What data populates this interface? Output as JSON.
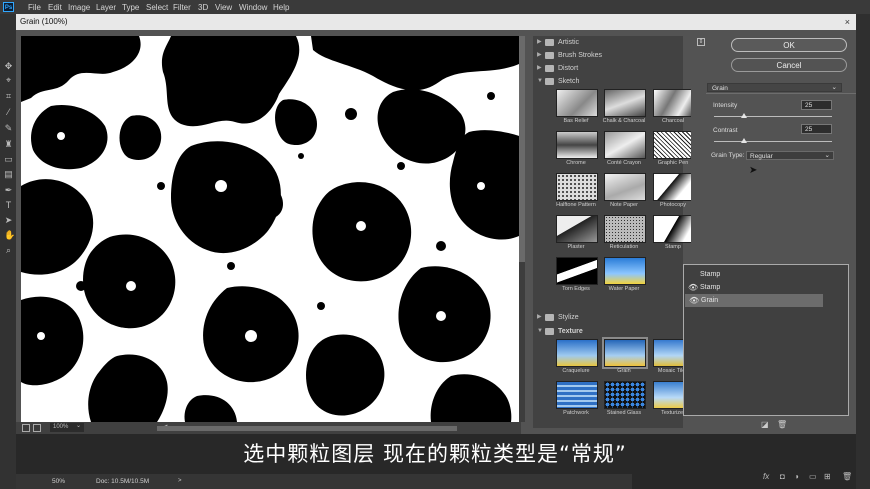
{
  "menubar": {
    "logo": "Ps",
    "items": [
      "File",
      "Edit",
      "Image",
      "Layer",
      "Type",
      "Select",
      "Filter",
      "3D",
      "View",
      "Window",
      "Help"
    ]
  },
  "dialog": {
    "title": "Grain (100%)",
    "close_glyph": "×",
    "zoom_level": "100%",
    "zoom_arrow": "⌄"
  },
  "filter_gallery": {
    "categories": [
      {
        "label": "Artistic",
        "expanded": false
      },
      {
        "label": "Brush Strokes",
        "expanded": false
      },
      {
        "label": "Distort",
        "expanded": false
      },
      {
        "label": "Sketch",
        "expanded": true
      },
      {
        "label": "Stylize",
        "expanded": false
      },
      {
        "label": "Texture",
        "expanded": true
      }
    ],
    "sketch_filters": [
      "Bas Relief",
      "Chalk & Charcoal",
      "Charcoal",
      "Chrome",
      "Conté Crayon",
      "Graphic Pen",
      "Halftone Pattern",
      "Note Paper",
      "Photocopy",
      "Plaster",
      "Reticulation",
      "Stamp",
      "Torn Edges",
      "Water Paper"
    ],
    "texture_filters": [
      "Craquelure",
      "Grain",
      "Mosaic Tiles",
      "Patchwork",
      "Stained Glass",
      "Texturizer"
    ],
    "selected_filter": "Grain"
  },
  "settings": {
    "ok_label": "OK",
    "cancel_label": "Cancel",
    "filter_name": "Grain",
    "select_arrow": "⌄",
    "intensity_label": "Intensity",
    "intensity_value": "25",
    "intensity_fraction": 0.25,
    "contrast_label": "Contrast",
    "contrast_value": "25",
    "contrast_fraction": 0.25,
    "grain_type_label": "Grain Type:",
    "grain_type_value": "Regular"
  },
  "effect_layers": [
    {
      "name": "Stamp",
      "visible": false,
      "selected": false
    },
    {
      "name": "Stamp",
      "visible": true,
      "selected": false
    },
    {
      "name": "Grain",
      "visible": true,
      "selected": true
    }
  ],
  "status": {
    "zoom": "50%",
    "doc": "Doc: 10.5M/10.5M",
    "arrow": ">"
  },
  "subtitle": "选中颗粒图层 现在的颗粒类型是“常规”",
  "layers_footer": {
    "fx": "fx"
  },
  "colors": {
    "accent": "#31a8ff",
    "dialog_bg": "#535353",
    "preview_ink": "#000000"
  }
}
